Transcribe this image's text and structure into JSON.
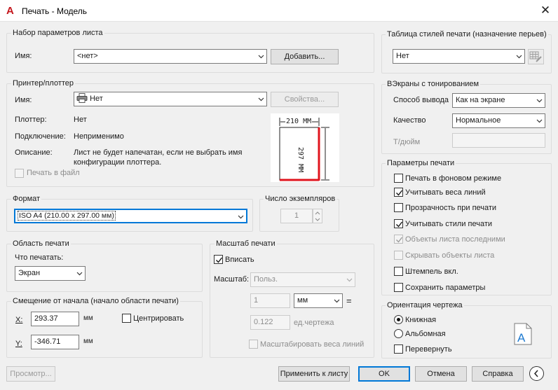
{
  "window": {
    "title": "Печать - Модель"
  },
  "page_setup": {
    "group": "Набор параметров листа",
    "name_label": "Имя:",
    "name_value": "<нет>",
    "add_button": "Добавить..."
  },
  "printer": {
    "group": "Принтер/плоттер",
    "name_label": "Имя:",
    "name_value": "Нет",
    "props_button": "Свойства...",
    "plotter_label": "Плоттер:",
    "plotter_value": "Нет",
    "connection_label": "Подключение:",
    "connection_value": "Неприменимо",
    "description_label": "Описание:",
    "description_line1": "Лист не будет напечатан, если не выбрать имя",
    "description_line2": "конфигурации плоттера.",
    "print_to_file": "Печать в файл"
  },
  "paper_preview": {
    "width_label": "210 ММ",
    "height_label": "297 ММ"
  },
  "paper_size": {
    "group": "Формат",
    "value": "ISO A4 (210.00 x 297.00 мм)"
  },
  "copies": {
    "group": "Число экземпляров",
    "value": "1"
  },
  "plot_area": {
    "group": "Область печати",
    "what_label": "Что печатать:",
    "what_value": "Экран"
  },
  "plot_offset": {
    "group": "Смещение от начала (начало области печати)",
    "x_label": "X:",
    "x_value": "293.37",
    "x_unit": "мм",
    "y_label": "Y:",
    "y_value": "-346.71",
    "y_unit": "мм",
    "center": "Центрировать"
  },
  "plot_scale": {
    "group": "Масштаб печати",
    "fit": "Вписать",
    "scale_label": "Масштаб:",
    "scale_value": "Польз.",
    "value1": "1",
    "unit1": "мм",
    "equals": "=",
    "value2": "0.122",
    "unit2": "ед.чертежа",
    "scale_lineweights": "Масштабировать веса линий"
  },
  "style_table": {
    "group": "Таблица стилей печати (назначение перьев)",
    "value": "Нет"
  },
  "shaded": {
    "group": "ВЭкраны с тонированием",
    "output_label": "Способ вывода",
    "output_value": "Как на экране",
    "quality_label": "Качество",
    "quality_value": "Нормальное",
    "dpi_label": "Т/дюйм"
  },
  "plot_options": {
    "group": "Параметры печати",
    "items": [
      "Печать в фоновом режиме",
      "Учитывать веса линий",
      "Прозрачность при печати",
      "Учитывать стили печати",
      "Объекты листа последними",
      "Скрывать объекты листа",
      "Штемпель вкл.",
      "Сохранить параметры"
    ]
  },
  "orientation": {
    "group": "Ориентация чертежа",
    "portrait": "Книжная",
    "landscape": "Альбомная",
    "upside_down": "Перевернуть"
  },
  "footer": {
    "preview": "Просмотр...",
    "apply": "Применить к листу",
    "ok": "OK",
    "cancel": "Отмена",
    "help": "Справка"
  },
  "colors": {
    "accent": "#0078d7",
    "paper_margin": "#e0141e",
    "app_icon": "#c4161c"
  }
}
